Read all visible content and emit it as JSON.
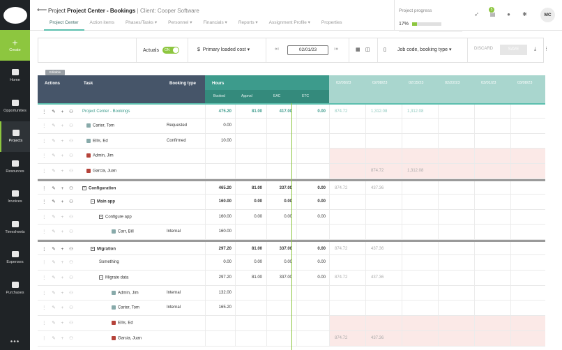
{
  "sidebar": {
    "create_label": "Create",
    "items": [
      {
        "label": "Home",
        "icon": "home-icon"
      },
      {
        "label": "Opportunities",
        "icon": "chat-icon"
      },
      {
        "label": "Projects",
        "icon": "folder-icon",
        "active": true
      },
      {
        "label": "Resources",
        "icon": "people-icon"
      },
      {
        "label": "Invoices",
        "icon": "invoice-icon"
      },
      {
        "label": "Timesheets",
        "icon": "clock-icon"
      },
      {
        "label": "Expenses",
        "icon": "expense-icon"
      },
      {
        "label": "Purchases",
        "icon": "cart-icon"
      }
    ],
    "more": "•••"
  },
  "header": {
    "crumb_prefix": "Project",
    "project_name": "Project Center - Bookings",
    "client": "Client: Cooper Software",
    "tabs": [
      {
        "label": "Project Center",
        "active": true
      },
      {
        "label": "Action items"
      },
      {
        "label": "Phases/Tasks ▾"
      },
      {
        "label": "Personnel ▾"
      },
      {
        "label": "Financials ▾"
      },
      {
        "label": "Reports ▾"
      },
      {
        "label": "Assignment Profile ▾"
      },
      {
        "label": "Properties"
      }
    ],
    "progress_label": "Project progress",
    "progress_value": "17%",
    "progress_fraction": 0.17,
    "notification_count": "5",
    "avatar": "MC"
  },
  "toolbar": {
    "actuals_label": "Actuals",
    "toggle_label": "ON",
    "cost_type": "Primary loaded cost",
    "date": "02/01/23",
    "group_by": "Job code, booking type",
    "discard": "DISCARD",
    "save": "SAVE"
  },
  "editable_badge": "Editable",
  "grid": {
    "headers": {
      "actions": "Actions",
      "task": "Task",
      "booking_type": "Booking type",
      "hours": "Hours",
      "booked": "Booked",
      "approved": "Apprvd",
      "eac": "EAC",
      "etc": "ETC",
      "dates": [
        "02/08/23",
        "02/08/23",
        "02/15/23",
        "02/22/23",
        "03/01/23",
        "03/08/23"
      ]
    },
    "rows": [
      {
        "task": "Project Center - Bookings",
        "type": "",
        "booked": "475.20",
        "apprvd": "81.00",
        "eac": "417.00",
        "etc": "0.00",
        "d1": "874.72",
        "d2": "1,312.08",
        "d3": "1,312.08",
        "style": "project"
      },
      {
        "task": "Carter, Tom",
        "type": "Requested",
        "booked": "0.00",
        "apprvd": "",
        "eac": "",
        "etc": "",
        "d1": "",
        "d2": "",
        "d3": "",
        "style": "person",
        "indent": 0
      },
      {
        "task": "Ellis, Ed",
        "type": "Confirmed",
        "booked": "10.00",
        "apprvd": "",
        "eac": "",
        "etc": "",
        "d1": "",
        "d2": "",
        "d3": "",
        "style": "person",
        "indent": 0
      },
      {
        "task": "Admin, Jim",
        "type": "",
        "booked": "",
        "apprvd": "",
        "eac": "",
        "etc": "",
        "d1": "",
        "d2": "",
        "d3": "",
        "style": "person-red",
        "indent": 0,
        "pink": true
      },
      {
        "task": "Garcia, Juan",
        "type": "",
        "booked": "",
        "apprvd": "",
        "eac": "",
        "etc": "",
        "d1": "",
        "d2": "874.72",
        "d3": "1,312.08",
        "style": "person-red",
        "indent": 0,
        "pink": true
      },
      {
        "task": "Configuration",
        "type": "",
        "booked": "465.20",
        "apprvd": "81.00",
        "eac": "337.00",
        "etc": "0.00",
        "d1": "874.72",
        "d2": "437.36",
        "d3": "",
        "style": "phase",
        "indent": 0
      },
      {
        "task": "Main app",
        "type": "",
        "booked": "160.00",
        "apprvd": "0.00",
        "eac": "0.00",
        "etc": "0.00",
        "d1": "",
        "d2": "",
        "d3": "",
        "style": "phase",
        "indent": 1
      },
      {
        "task": "Configure app",
        "type": "",
        "booked": "160.00",
        "apprvd": "0.00",
        "eac": "0.00",
        "etc": "0.00",
        "d1": "",
        "d2": "",
        "d3": "",
        "style": "task",
        "indent": 2
      },
      {
        "task": "Carr, Bill",
        "type": "Internal",
        "booked": "160.00",
        "apprvd": "",
        "eac": "",
        "etc": "",
        "d1": "",
        "d2": "",
        "d3": "",
        "style": "person",
        "indent": 3
      },
      {
        "task": "Migration",
        "type": "",
        "booked": "297.20",
        "apprvd": "81.00",
        "eac": "337.00",
        "etc": "0.00",
        "d1": "874.72",
        "d2": "437.36",
        "d3": "",
        "style": "phase",
        "indent": 1
      },
      {
        "task": "Something",
        "type": "",
        "booked": "0.00",
        "apprvd": "0.00",
        "eac": "0.00",
        "etc": "0.00",
        "d1": "",
        "d2": "",
        "d3": "",
        "style": "task",
        "indent": 2
      },
      {
        "task": "Migrate data",
        "type": "",
        "booked": "297.20",
        "apprvd": "81.00",
        "eac": "337.00",
        "etc": "0.00",
        "d1": "874.72",
        "d2": "437.36",
        "d3": "",
        "style": "task-box",
        "indent": 2
      },
      {
        "task": "Admin, Jim",
        "type": "Internal",
        "booked": "132.00",
        "apprvd": "",
        "eac": "",
        "etc": "",
        "d1": "",
        "d2": "",
        "d3": "",
        "style": "person",
        "indent": 3
      },
      {
        "task": "Carter, Tom",
        "type": "Internal",
        "booked": "165.20",
        "apprvd": "",
        "eac": "",
        "etc": "",
        "d1": "",
        "d2": "",
        "d3": "",
        "style": "person",
        "indent": 3
      },
      {
        "task": "Ellis, Ed",
        "type": "",
        "booked": "",
        "apprvd": "",
        "eac": "",
        "etc": "",
        "d1": "",
        "d2": "",
        "d3": "",
        "style": "person-red",
        "indent": 3,
        "pink": true
      },
      {
        "task": "Garcia, Juan",
        "type": "",
        "booked": "",
        "apprvd": "",
        "eac": "",
        "etc": "",
        "d1": "874.72",
        "d2": "437.36",
        "d3": "",
        "style": "person-red",
        "indent": 3,
        "pink": true
      }
    ]
  },
  "colors": {
    "accent_green": "#8dc63f",
    "header_dark": "#465569",
    "header_teal": "#3d9b8c",
    "header_teal_light": "#a9d6ce",
    "sidebar_bg": "#1f2326"
  }
}
